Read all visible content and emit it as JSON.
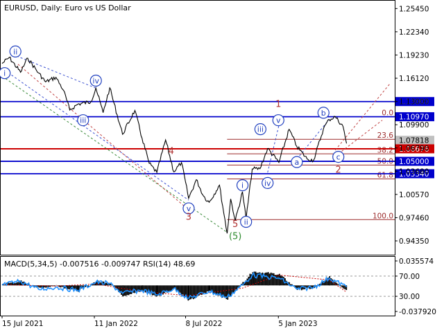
{
  "header": {
    "symbol_line": "EURUSD, Daily:  Euro vs US Dollar",
    "indicator_line": "MACD(5,34,5) -0.007516 -0.009747 RSI(14) 48.69"
  },
  "colors": {
    "background": "#ffffff",
    "axis": "#000000",
    "price_line": "#000000",
    "level_blue": "#0000cc",
    "level_red": "#cc0000",
    "wave_blue": "#1f3fbf",
    "wave_red": "#b03030",
    "wave_green": "#2e8b2e",
    "fib_line": "#9b2a2a",
    "trend_blue_dash": "#3a4fd0",
    "trend_red_dash": "#c04040",
    "trend_green_dash": "#3a8a3a",
    "rsi_line": "#1e90ff",
    "macd_hist": "#000000",
    "macd_signal": "#cc0000",
    "tag_blue_bg": "#0000cc",
    "tag_red_bg": "#cc0000",
    "tag_grey_bg": "#c0c0c0"
  },
  "chart_data": [
    {
      "type": "line",
      "title": "EURUSD, Daily:  Euro vs US Dollar",
      "x_tick_labels": [
        "15 Jul 2021",
        "11 Jan 2022",
        "8 Jul 2022",
        "5 Jan 2023"
      ],
      "x_range": [
        "2021-07-15",
        "2023-05-20"
      ],
      "y_tick_labels": [
        "1.25450",
        "1.22340",
        "1.19230",
        "1.16120",
        "1.13000",
        "1.09900",
        "1.06790",
        "1.03680",
        "1.00570",
        "0.97460",
        "0.94350"
      ],
      "ylim": [
        0.925,
        1.265
      ],
      "series": [
        {
          "x": [
            "2021-07-15",
            "2021-07-29",
            "2021-08-20",
            "2021-09-03",
            "2021-09-24",
            "2021-10-08",
            "2021-10-28",
            "2021-11-12",
            "2021-11-24",
            "2021-12-10",
            "2022-01-04",
            "2022-01-14",
            "2022-01-28",
            "2022-02-10",
            "2022-03-07",
            "2022-03-31",
            "2022-04-14",
            "2022-04-28",
            "2022-05-13",
            "2022-05-30",
            "2022-06-15",
            "2022-06-30",
            "2022-07-14",
            "2022-07-29",
            "2022-08-12",
            "2022-08-23",
            "2022-09-12",
            "2022-09-27",
            "2022-10-04",
            "2022-10-13",
            "2022-10-27",
            "2022-11-03",
            "2022-11-15",
            "2022-11-30",
            "2022-12-15",
            "2023-01-06",
            "2023-01-26",
            "2023-02-10",
            "2023-03-02",
            "2023-03-15",
            "2023-04-03",
            "2023-04-14",
            "2023-04-26",
            "2023-05-11",
            "2023-05-18"
          ],
          "y": [
            1.181,
            1.189,
            1.1692,
            1.1881,
            1.1683,
            1.1563,
            1.1624,
            1.1449,
            1.1186,
            1.1266,
            1.1296,
            1.1482,
            1.1152,
            1.1484,
            1.0862,
            1.1182,
            1.0811,
            1.0472,
            1.0351,
            1.0786,
            1.0359,
            1.0484,
            1.0005,
            1.0254,
            1.0035,
            0.9951,
            1.0181,
            0.9535,
            0.9997,
            0.9705,
            1.0093,
            0.9731,
            1.0398,
            1.0401,
            1.0672,
            1.0485,
            1.0929,
            1.0699,
            1.0533,
            1.0516,
            1.0938,
            1.106,
            1.1097,
            1.0969,
            1.074
          ]
        }
      ],
      "horizontal_levels": [
        {
          "label": "1.13000",
          "value": 1.13,
          "color": "blue"
        },
        {
          "label": "1.10970",
          "value": 1.1097,
          "color": "blue"
        },
        {
          "label": "1.07818",
          "value": 1.07818,
          "color": "grey"
        },
        {
          "label": "1.06676",
          "value": 1.06676,
          "color": "red"
        },
        {
          "label": "1.05000",
          "value": 1.05,
          "color": "blue"
        },
        {
          "label": "1.03340",
          "value": 1.0334,
          "color": "blue"
        }
      ],
      "fib_levels": [
        {
          "label": "0.0",
          "value": 1.1097
        },
        {
          "label": "23.6",
          "value": 1.0795
        },
        {
          "label": "38.2",
          "value": 1.06
        },
        {
          "label": "50.0",
          "value": 1.045
        },
        {
          "label": "61.8",
          "value": 1.0265
        },
        {
          "label": "100.0",
          "value": 0.972
        }
      ],
      "wave_labels": {
        "blue_circled": [
          {
            "text": "i",
            "x": "2021-07-20",
            "y": 1.168
          },
          {
            "text": "ii",
            "x": "2021-08-10",
            "y": 1.197
          },
          {
            "text": "iii",
            "x": "2021-12-20",
            "y": 1.105
          },
          {
            "text": "iv",
            "x": "2022-01-14",
            "y": 1.158
          },
          {
            "text": "v",
            "x": "2022-07-14",
            "y": 0.987
          },
          {
            "text": "i",
            "x": "2022-10-27",
            "y": 1.018
          },
          {
            "text": "ii",
            "x": "2022-11-03",
            "y": 0.969
          },
          {
            "text": "iii",
            "x": "2022-12-01",
            "y": 1.093
          },
          {
            "text": "iv",
            "x": "2022-12-15",
            "y": 1.021
          },
          {
            "text": "v",
            "x": "2023-01-05",
            "y": 1.105
          },
          {
            "text": "a",
            "x": "2023-02-10",
            "y": 1.049
          },
          {
            "text": "b",
            "x": "2023-04-03",
            "y": 1.115
          },
          {
            "text": "c",
            "x": "2023-05-02",
            "y": 1.056
          }
        ],
        "red_plain": [
          {
            "text": "4",
            "x": "2022-06-10",
            "y": 1.06
          },
          {
            "text": "3",
            "x": "2022-07-14",
            "y": 0.972
          },
          {
            "text": "5",
            "x": "2022-10-13",
            "y": 0.962
          },
          {
            "text": "1",
            "x": "2023-01-05",
            "y": 1.123
          },
          {
            "text": "2",
            "x": "2023-05-02",
            "y": 1.035
          }
        ],
        "green_paren": [
          {
            "text": "(5)",
            "x": "2022-10-13",
            "y": 0.946
          }
        ]
      }
    },
    {
      "type": "line",
      "title": "MACD(5,34,5) -0.007516 -0.009747 RSI(14) 48.69",
      "y_tick_labels": [
        "0.035574",
        "70.00",
        "30.00",
        "-0.037920"
      ],
      "ylim": [
        -0.03792,
        0.035574
      ],
      "rsi_levels": [
        70,
        30
      ],
      "series": [
        {
          "name": "RSI(14)",
          "x": [
            "2021-07-15",
            "2021-08-20",
            "2021-09-24",
            "2021-10-28",
            "2021-12-10",
            "2022-01-14",
            "2022-02-10",
            "2022-03-07",
            "2022-04-14",
            "2022-05-13",
            "2022-06-15",
            "2022-07-14",
            "2022-08-23",
            "2022-09-27",
            "2022-10-27",
            "2022-11-15",
            "2022-12-15",
            "2023-01-06",
            "2023-02-10",
            "2023-03-15",
            "2023-04-14",
            "2023-05-18"
          ],
          "y": [
            52,
            60,
            44,
            48,
            42,
            58,
            55,
            36,
            42,
            33,
            45,
            26,
            40,
            28,
            52,
            72,
            68,
            66,
            44,
            48,
            66,
            48.69
          ]
        },
        {
          "name": "MACD",
          "x": [
            "2021-07-15",
            "2021-08-20",
            "2021-09-24",
            "2021-10-28",
            "2021-12-10",
            "2022-01-14",
            "2022-02-10",
            "2022-03-07",
            "2022-04-14",
            "2022-05-13",
            "2022-06-15",
            "2022-07-14",
            "2022-08-23",
            "2022-09-27",
            "2022-10-27",
            "2022-11-15",
            "2022-12-15",
            "2023-01-06",
            "2023-02-10",
            "2023-03-15",
            "2023-04-14",
            "2023-05-18"
          ],
          "y": [
            0.002,
            0.006,
            -0.004,
            0.0,
            -0.008,
            0.006,
            0.004,
            -0.015,
            -0.008,
            -0.016,
            -0.004,
            -0.022,
            -0.008,
            -0.02,
            0.004,
            0.02,
            0.018,
            0.016,
            -0.006,
            -0.004,
            0.012,
            -0.007516
          ]
        },
        {
          "name": "Signal",
          "x": [
            "2021-07-15",
            "2021-10-28",
            "2022-01-14",
            "2022-04-14",
            "2022-07-14",
            "2022-10-27",
            "2023-01-06",
            "2023-04-14",
            "2023-05-18"
          ],
          "y": [
            0.001,
            -0.001,
            0.002,
            -0.009,
            -0.015,
            -0.004,
            0.015,
            0.008,
            -0.009747
          ]
        }
      ]
    }
  ]
}
